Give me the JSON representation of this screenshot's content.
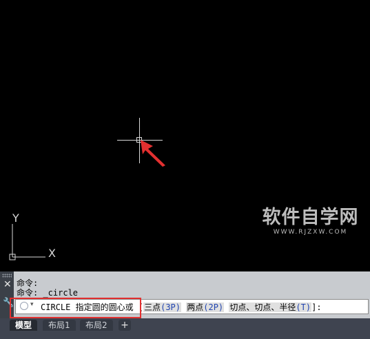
{
  "viewport": {
    "ucs_labels": {
      "x": "X",
      "y": "Y"
    }
  },
  "watermark": {
    "main": "软件自学网",
    "sub": "WWW.RJZXW.COM"
  },
  "command_window": {
    "history": [
      "命令:",
      "命令: _circle"
    ],
    "prompt": {
      "command": "CIRCLE",
      "text": "指定圆的圆心或",
      "open_bracket": "[",
      "options": [
        {
          "label": "三点",
          "key": "(3P)"
        },
        {
          "label": "两点",
          "key": "(2P)"
        },
        {
          "label": "切点、切点、半径",
          "key": "(T)"
        }
      ],
      "close": "]:"
    }
  },
  "layout_tabs": [
    "模型",
    "布局1",
    "布局2"
  ],
  "add_tab_label": "+",
  "colors": {
    "annotation": "#e33030",
    "canvas": "#000000",
    "key": "#2044b0"
  }
}
